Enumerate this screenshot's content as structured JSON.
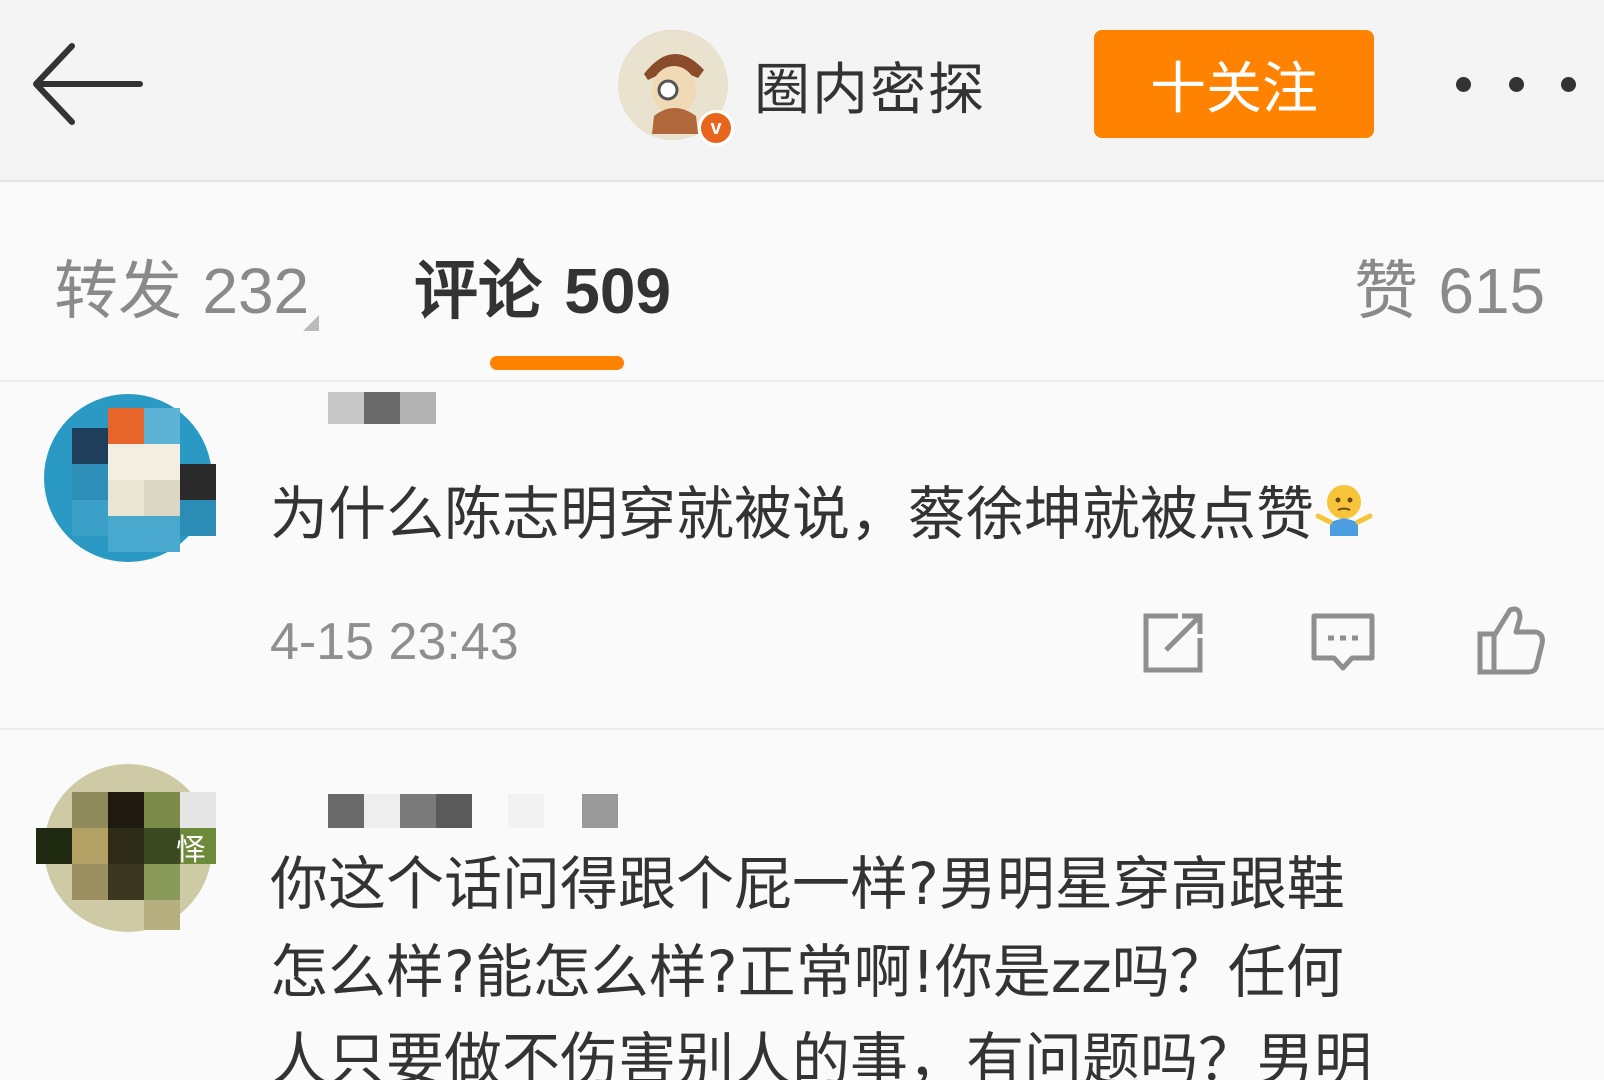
{
  "header": {
    "author_name": "圈内密探",
    "verified_badge": "v",
    "follow_label": "十关注",
    "icons": {
      "back": "back-arrow-icon",
      "more": "more-dots-icon"
    }
  },
  "tabs": {
    "repost": {
      "label": "转发",
      "count": "232"
    },
    "comment": {
      "label": "评论",
      "count": "509"
    },
    "like": {
      "label": "赞",
      "count": "615"
    },
    "active": "comment",
    "accent_color": "#ff8200"
  },
  "comments": [
    {
      "text": "为什么陈志明穿就被说，蔡徐坤就被点赞",
      "emoji": "shrug-emoji",
      "time": "4-15 23:43",
      "actions": [
        "share-icon",
        "reply-icon",
        "like-icon"
      ]
    },
    {
      "text_lines": [
        "你这个话问得跟个屁一样?男明星穿高跟鞋",
        "怎么样?能怎么样?正常啊!你是zz吗？任何",
        "人只要做不伤害别人的事，有问题吗？男明"
      ],
      "avatar_caption": "怿"
    }
  ]
}
